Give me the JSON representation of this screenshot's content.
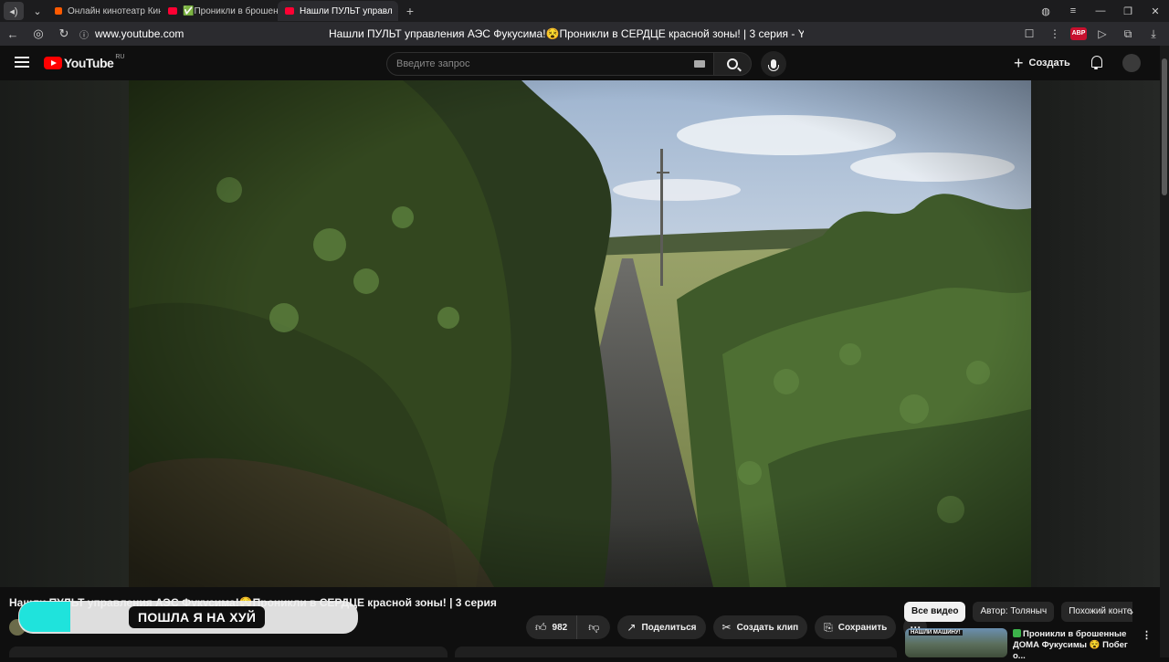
{
  "browser": {
    "tabs": [
      {
        "label": "Онлайн кинотеатр Кинопоиск",
        "favicon": "kinopoisk-icon",
        "active": false
      },
      {
        "label": "✅Проникли в брошенные",
        "favicon": "youtube-icon",
        "active": false
      },
      {
        "label": "Нашли ПУЛЬТ управл",
        "favicon": "youtube-icon",
        "active": true
      }
    ],
    "url": "www.youtube.com",
    "page_title": "Нашли ПУЛЬТ управления АЭС Фукусима!😵Проникли в СЕРДЦЕ красной зоны! | 3 серия - YouTube",
    "adblock_badge": "ABP"
  },
  "youtube": {
    "logo_text": "YouTube",
    "region": "RU",
    "search_placeholder": "Введите запрос",
    "create_label": "Создать"
  },
  "video": {
    "title": "Нашли ПУЛЬТ управления АЭС Фукусима!😵Проникли в СЕРДЦЕ красной зоны! | 3 серия",
    "likes": "982",
    "share_label": "Поделиться",
    "clip_label": "Создать клип",
    "save_label": "Сохранить",
    "overlay_caption": "ПОШЛА Я НА ХУЙ"
  },
  "sidebar": {
    "chips": [
      "Все видео",
      "Автор: Толяныч",
      "Похожий контент"
    ],
    "recommendation": {
      "thumb_label": "НАШЛИ МАШИНУ!",
      "title": "Проникли в брошенные ДОМА Фукусимы 😵 Побег о..."
    }
  },
  "colors": {
    "accent": "#ff0000",
    "overlay_accent": "#1fe3dc",
    "background": "#0f0f0f"
  }
}
